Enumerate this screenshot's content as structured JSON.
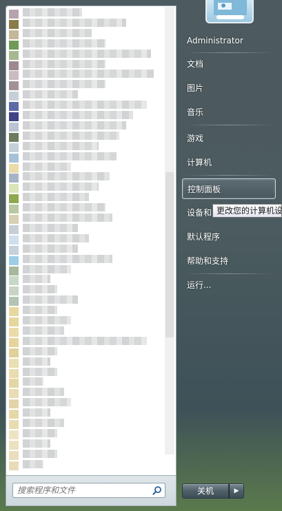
{
  "right_pane": {
    "items": [
      {
        "label": "Administrator"
      },
      {
        "label": "文档"
      },
      {
        "label": "图片"
      },
      {
        "label": "音乐"
      },
      {
        "label": "游戏"
      },
      {
        "label": "计算机"
      },
      {
        "label": "控制面板"
      },
      {
        "label": "设备和"
      },
      {
        "label": "默认程序"
      },
      {
        "label": "帮助和支持"
      },
      {
        "label": "运行..."
      }
    ]
  },
  "tooltip": {
    "text": "更改您的计算机设"
  },
  "search": {
    "placeholder": "搜索程序和文件"
  },
  "shutdown": {
    "label": "关机",
    "arrow": "▶"
  },
  "programs": {
    "icon_colors": [
      "#b7a3b0",
      "#8a7c4a",
      "#c6b69a",
      "#6f9a58",
      "#a7b890",
      "#9c8a90",
      "#c8bcc2",
      "#a29296",
      "#c7cfd6",
      "#5d6aa8",
      "#3e4486",
      "#b9c4d2",
      "#6b7d5c",
      "#c4d0d8",
      "#a7c2d8",
      "#e9dca8",
      "#a6b4c6",
      "#d9e4b8",
      "#8ea84e",
      "#b8c8a4",
      "#d6cfb0",
      "#c6cfd6",
      "#cfe0ec",
      "#c5d2dc",
      "#9ccde8",
      "#a8b89e",
      "#c6d9c6",
      "#c8d4c6",
      "#b2c4b4",
      "#e8d8a0",
      "#e6d69c",
      "#eadca8",
      "#e6d49c",
      "#e0d09a",
      "#eadfb2",
      "#e8dcb0",
      "#e4d6a4",
      "#e8dcb4",
      "#e2d4a8",
      "#e6d8a8",
      "#e8dcb0",
      "#eee4c4",
      "#ece2c0",
      "#eadebc",
      "#e8dcb8"
    ],
    "label_widths": [
      86,
      150,
      100,
      120,
      186,
      120,
      190,
      120,
      80,
      180,
      160,
      150,
      140,
      110,
      136,
      70,
      126,
      110,
      96,
      120,
      130,
      80,
      96,
      80,
      130,
      70,
      40,
      50,
      80,
      50,
      70,
      60,
      180,
      50,
      40,
      50,
      30,
      60,
      70,
      40,
      60,
      50,
      40,
      50,
      30
    ]
  }
}
